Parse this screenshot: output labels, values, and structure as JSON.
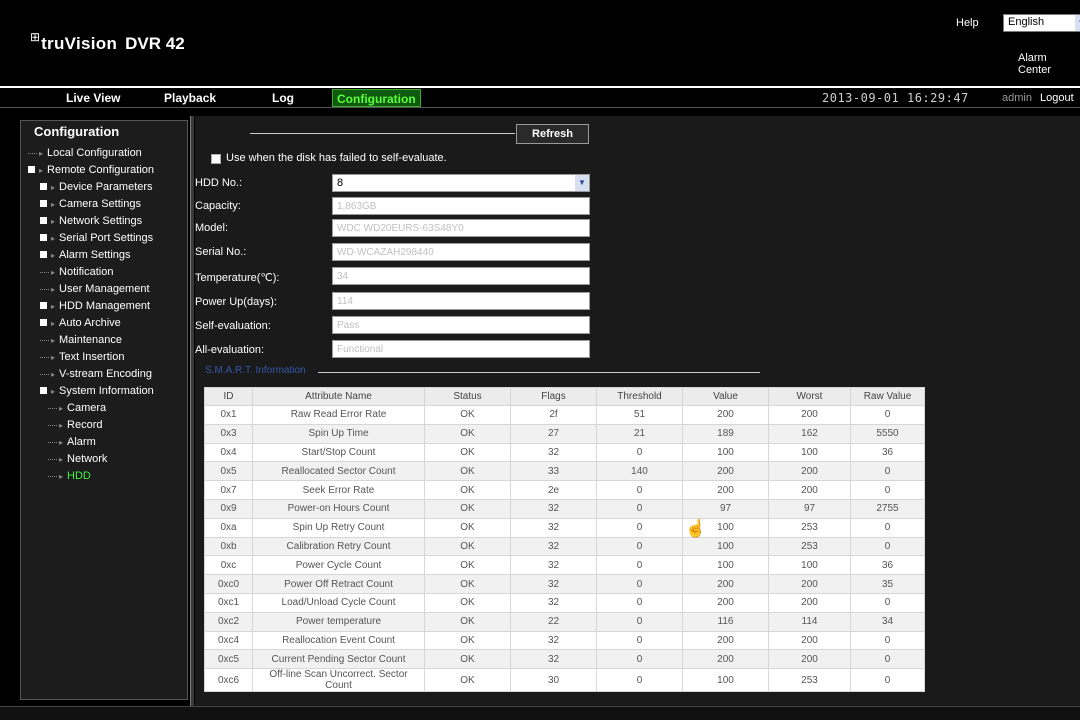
{
  "header": {
    "logo_mark": "⊞",
    "logo_brand": "truVision",
    "logo_model": "DVR 42",
    "help": "Help",
    "language": "English",
    "alarm_center": "Alarm Center"
  },
  "nav": {
    "items": [
      "Live View",
      "Playback",
      "Log",
      "Configuration"
    ],
    "active": "Configuration",
    "datetime": "2013-09-01 16:29:47",
    "user": "admin",
    "logout": "Logout"
  },
  "sidebar": {
    "title": "Configuration",
    "items": [
      {
        "label": "Local Configuration",
        "kind": "leaf",
        "level": 0
      },
      {
        "label": "Remote Configuration",
        "kind": "expanded",
        "level": 0
      },
      {
        "label": "Device Parameters",
        "kind": "collapsed",
        "level": 1
      },
      {
        "label": "Camera Settings",
        "kind": "collapsed",
        "level": 1
      },
      {
        "label": "Network Settings",
        "kind": "collapsed",
        "level": 1
      },
      {
        "label": "Serial Port Settings",
        "kind": "collapsed",
        "level": 1
      },
      {
        "label": "Alarm Settings",
        "kind": "collapsed",
        "level": 1
      },
      {
        "label": "Notification",
        "kind": "leaf",
        "level": 1
      },
      {
        "label": "User Management",
        "kind": "leaf",
        "level": 1
      },
      {
        "label": "HDD Management",
        "kind": "collapsed",
        "level": 1
      },
      {
        "label": "Auto Archive",
        "kind": "collapsed",
        "level": 1
      },
      {
        "label": "Maintenance",
        "kind": "leaf",
        "level": 1
      },
      {
        "label": "Text Insertion",
        "kind": "leaf",
        "level": 1
      },
      {
        "label": "V-stream Encoding",
        "kind": "leaf",
        "level": 1
      },
      {
        "label": "System Information",
        "kind": "expanded",
        "level": 1
      },
      {
        "label": "Camera",
        "kind": "leaf",
        "level": 2
      },
      {
        "label": "Record",
        "kind": "leaf",
        "level": 2
      },
      {
        "label": "Alarm",
        "kind": "leaf",
        "level": 2
      },
      {
        "label": "Network",
        "kind": "leaf",
        "level": 2
      },
      {
        "label": "HDD",
        "kind": "leaf",
        "level": 2,
        "active": true
      }
    ]
  },
  "main": {
    "refresh": "Refresh",
    "checkbox_label": "Use when the disk has failed to self-evaluate.",
    "fields": [
      {
        "label": "HDD No.:",
        "value": "8",
        "type": "select"
      },
      {
        "label": "Capacity:",
        "value": "1,863GB"
      },
      {
        "label": "Model:",
        "value": "WDC WD20EURS-63S48Y0"
      },
      {
        "label": "Serial No.:",
        "value": "WD-WCAZAH298440"
      },
      {
        "label": "Temperature(℃):",
        "value": "34"
      },
      {
        "label": "Power Up(days):",
        "value": "114"
      },
      {
        "label": "Self-evaluation:",
        "value": "Pass"
      },
      {
        "label": "All-evaluation:",
        "value": "Functional"
      }
    ],
    "smart_title": "S.M.A.R.T. Information",
    "table": {
      "headers": [
        "ID",
        "Attribute Name",
        "Status",
        "Flags",
        "Threshold",
        "Value",
        "Worst",
        "Raw Value"
      ],
      "rows": [
        [
          "0x1",
          "Raw Read Error Rate",
          "OK",
          "2f",
          "51",
          "200",
          "200",
          "0"
        ],
        [
          "0x3",
          "Spin Up Time",
          "OK",
          "27",
          "21",
          "189",
          "162",
          "5550"
        ],
        [
          "0x4",
          "Start/Stop Count",
          "OK",
          "32",
          "0",
          "100",
          "100",
          "36"
        ],
        [
          "0x5",
          "Reallocated Sector Count",
          "OK",
          "33",
          "140",
          "200",
          "200",
          "0"
        ],
        [
          "0x7",
          "Seek Error Rate",
          "OK",
          "2e",
          "0",
          "200",
          "200",
          "0"
        ],
        [
          "0x9",
          "Power-on Hours Count",
          "OK",
          "32",
          "0",
          "97",
          "97",
          "2755"
        ],
        [
          "0xa",
          "Spin Up Retry Count",
          "OK",
          "32",
          "0",
          "100",
          "253",
          "0"
        ],
        [
          "0xb",
          "Calibration Retry Count",
          "OK",
          "32",
          "0",
          "100",
          "253",
          "0"
        ],
        [
          "0xc",
          "Power Cycle Count",
          "OK",
          "32",
          "0",
          "100",
          "100",
          "36"
        ],
        [
          "0xc0",
          "Power Off Retract Count",
          "OK",
          "32",
          "0",
          "200",
          "200",
          "35"
        ],
        [
          "0xc1",
          "Load/Unload Cycle Count",
          "OK",
          "32",
          "0",
          "200",
          "200",
          "0"
        ],
        [
          "0xc2",
          "Power temperature",
          "OK",
          "22",
          "0",
          "116",
          "114",
          "34"
        ],
        [
          "0xc4",
          "Reallocation Event Count",
          "OK",
          "32",
          "0",
          "200",
          "200",
          "0"
        ],
        [
          "0xc5",
          "Current Pending Sector Count",
          "OK",
          "32",
          "0",
          "200",
          "200",
          "0"
        ],
        [
          "0xc6",
          "Off-line Scan Uncorrect. Sector Count",
          "OK",
          "30",
          "0",
          "100",
          "253",
          "0"
        ]
      ]
    }
  },
  "colors": {
    "active_green": "#3df03d",
    "nav_active_bg": "#0f5a0f",
    "smart_title": "#3557a7"
  },
  "icons": {
    "cursor": "hand-pointer-icon",
    "lang_dropdown": "chevron-down-icon",
    "hdd_dropdown": "chevron-down-icon"
  }
}
